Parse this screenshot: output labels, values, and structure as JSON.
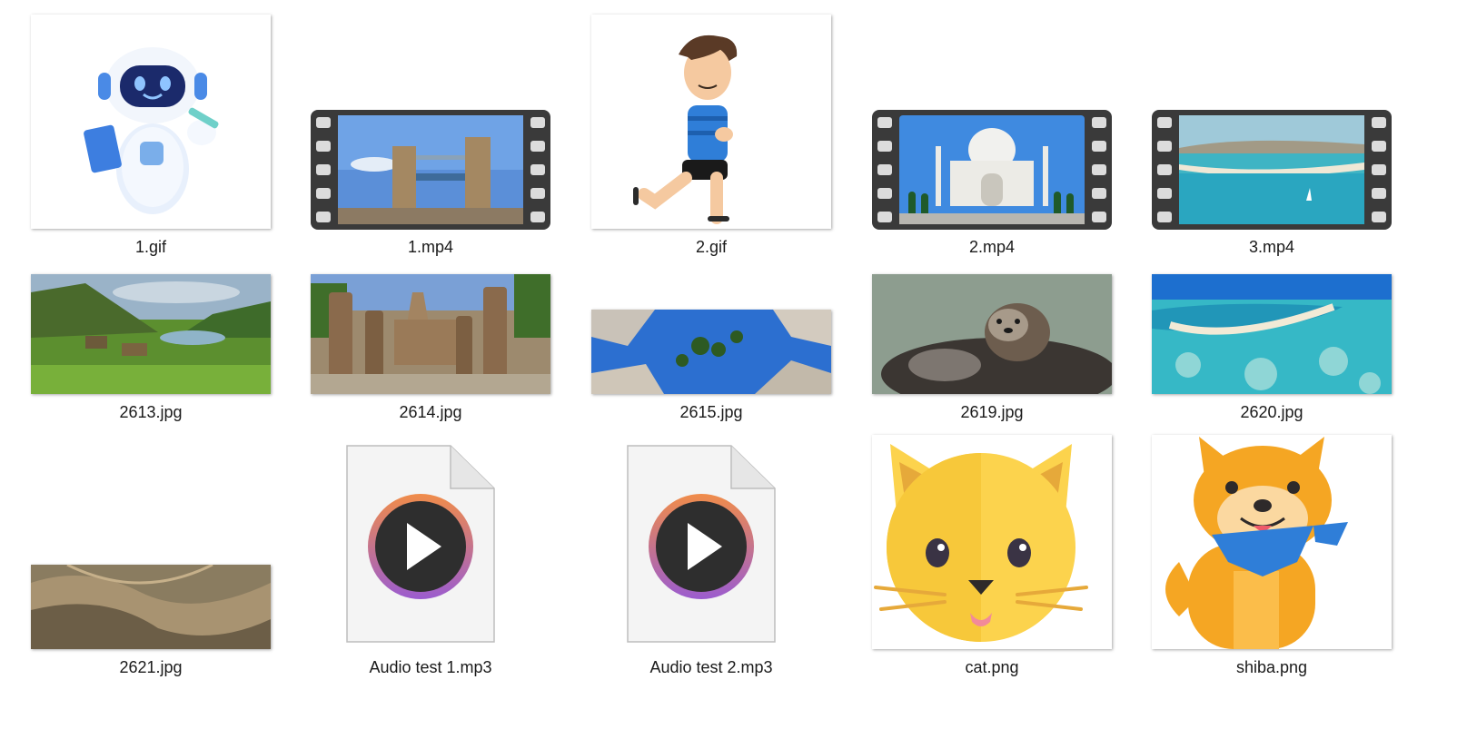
{
  "files": [
    {
      "name": "1.gif",
      "type": "animated-image",
      "thumbnail": "robot-mascot-icon"
    },
    {
      "name": "1.mp4",
      "type": "video",
      "thumbnail": "tower-bridge-video-icon"
    },
    {
      "name": "2.gif",
      "type": "animated-image",
      "thumbnail": "running-boy-icon"
    },
    {
      "name": "2.mp4",
      "type": "video",
      "thumbnail": "taj-mahal-video-icon"
    },
    {
      "name": "3.mp4",
      "type": "video",
      "thumbnail": "beach-bay-video-icon"
    },
    {
      "name": "2613.jpg",
      "type": "image",
      "thumbnail": "green-valley-village-photo"
    },
    {
      "name": "2614.jpg",
      "type": "image",
      "thumbnail": "temple-ruins-photo"
    },
    {
      "name": "2615.jpg",
      "type": "image",
      "thumbnail": "palm-trees-sky-photo"
    },
    {
      "name": "2619.jpg",
      "type": "image",
      "thumbnail": "sea-otter-photo"
    },
    {
      "name": "2620.jpg",
      "type": "image",
      "thumbnail": "coral-reef-aerial-photo"
    },
    {
      "name": "2621.jpg",
      "type": "image",
      "thumbnail": "desert-dunes-photo"
    },
    {
      "name": "Audio test 1.mp3",
      "type": "audio",
      "thumbnail": "audio-play-file-icon"
    },
    {
      "name": "Audio test 2.mp3",
      "type": "audio",
      "thumbnail": "audio-play-file-icon"
    },
    {
      "name": "cat.png",
      "type": "image",
      "thumbnail": "cat-face-icon"
    },
    {
      "name": "shiba.png",
      "type": "image",
      "thumbnail": "shiba-dog-icon"
    }
  ],
  "colors": {
    "filmstrip": "#3a3a3a",
    "play_ring_start": "#f08c4a",
    "play_ring_end": "#9b5ccf",
    "cat_yellow": "#fcd34d",
    "shiba_orange": "#f5a623"
  }
}
